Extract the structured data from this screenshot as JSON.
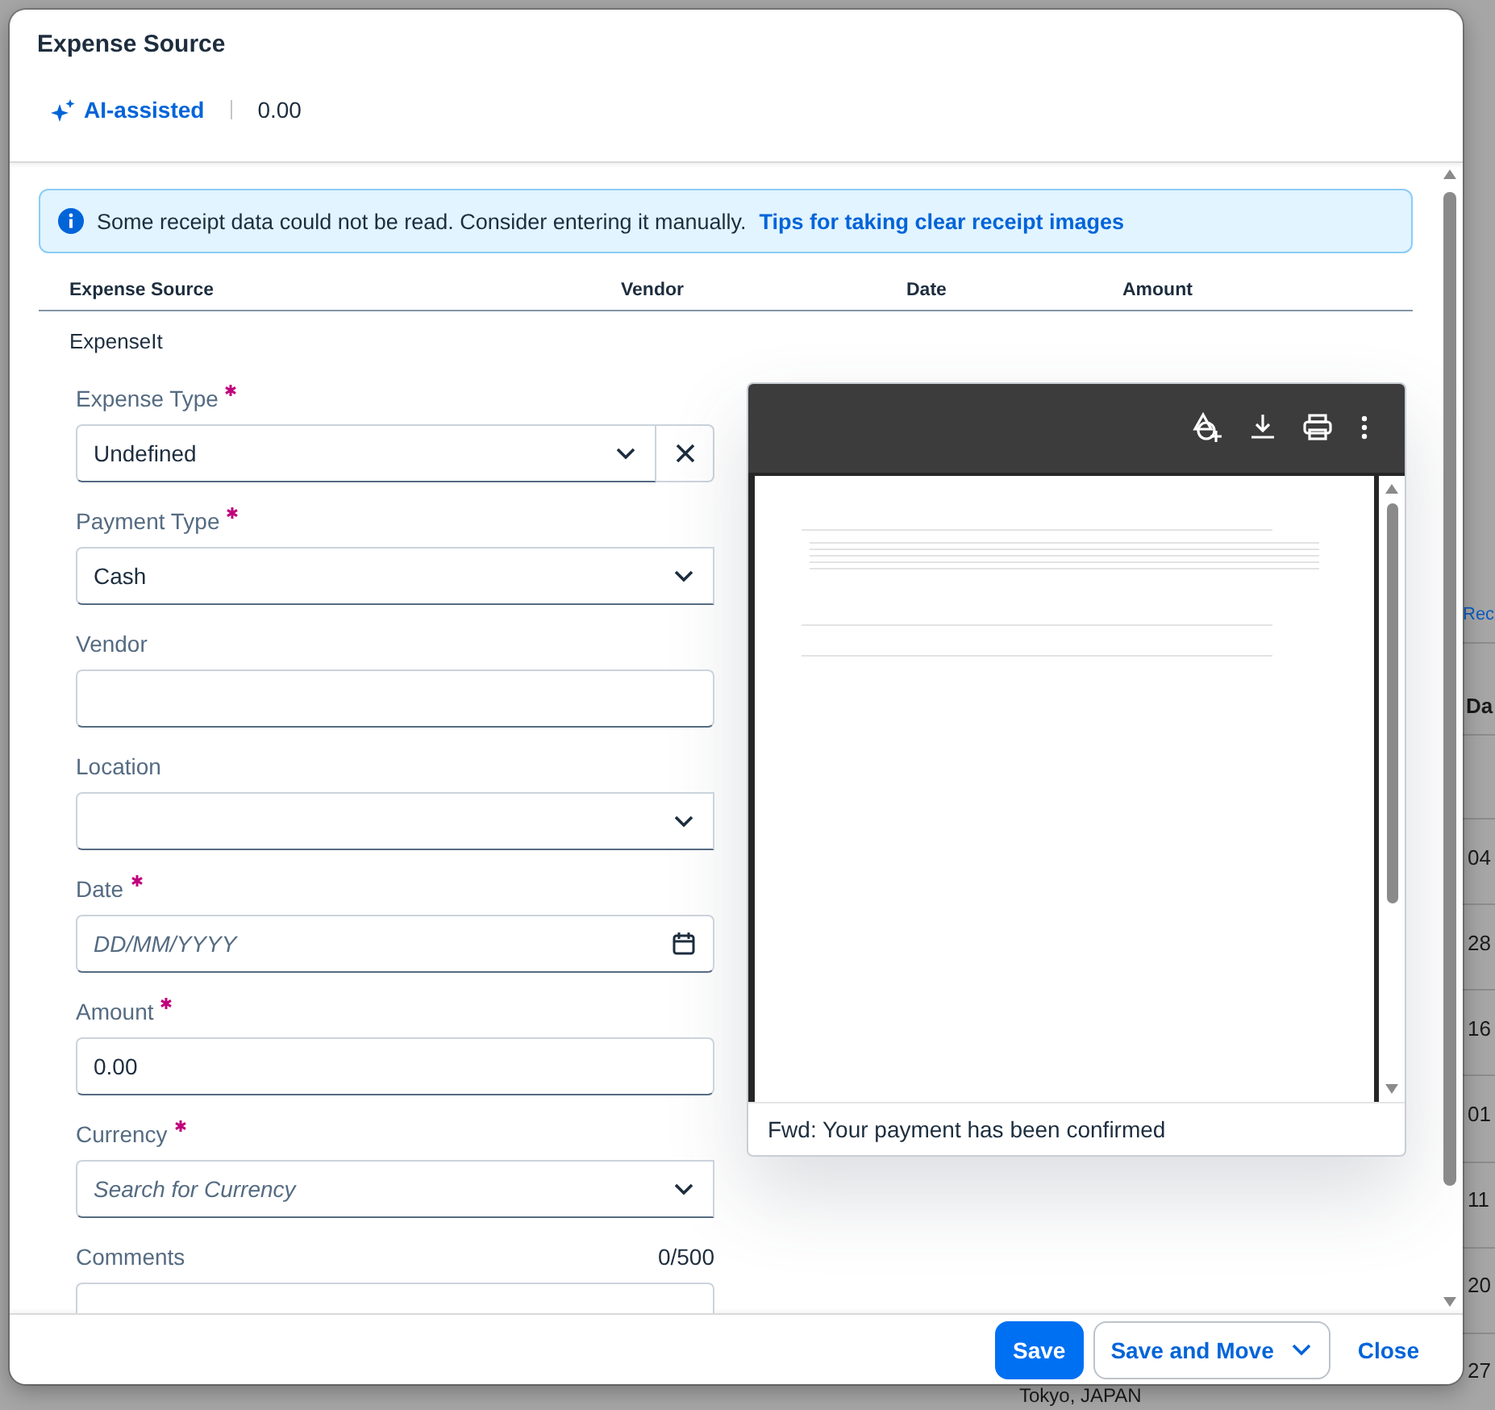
{
  "background": {
    "link": "Rec",
    "column_header": "Da",
    "column_cells": [
      "04",
      "28",
      "16",
      "01",
      "11",
      "20",
      "27"
    ],
    "location": "Tokyo, JAPAN"
  },
  "dialog": {
    "title": "Expense Source",
    "ai_label": "AI-assisted",
    "total": "0.00"
  },
  "alert": {
    "message": "Some receipt data could not be read. Consider entering it manually.",
    "link": "Tips for taking clear receipt images"
  },
  "table": {
    "columns": [
      "Expense Source",
      "Vendor",
      "Date",
      "Amount"
    ],
    "rows": [
      {
        "cells": [
          "ExpenseIt"
        ]
      }
    ]
  },
  "form": {
    "fields": [
      {
        "label": "Expense Type",
        "required": true,
        "kind": "select",
        "value": "Undefined",
        "clearable": true
      },
      {
        "label": "Payment Type",
        "required": true,
        "kind": "select",
        "value": "Cash",
        "clearable": false
      },
      {
        "label": "Vendor",
        "required": false,
        "kind": "text"
      },
      {
        "label": "Location",
        "required": false,
        "kind": "select",
        "clearable": false
      },
      {
        "label": "Date",
        "required": true,
        "kind": "date",
        "placeholder": "DD/MM/YYYY"
      },
      {
        "label": "Amount",
        "required": true,
        "kind": "text",
        "value": "0.00"
      },
      {
        "label": "Currency",
        "required": true,
        "kind": "select",
        "placeholder": "Search for Currency",
        "clearable": false
      },
      {
        "label": "Comments",
        "required": false,
        "kind": "textarea",
        "counter": "0/500"
      }
    ]
  },
  "viewer": {
    "caption": "Fwd: Your payment has been confirmed"
  },
  "footer": {
    "buttons": [
      {
        "label": "Save",
        "kind": "primary"
      },
      {
        "label": "Save and Move",
        "kind": "menu"
      },
      {
        "label": "Close",
        "kind": "link"
      }
    ]
  }
}
